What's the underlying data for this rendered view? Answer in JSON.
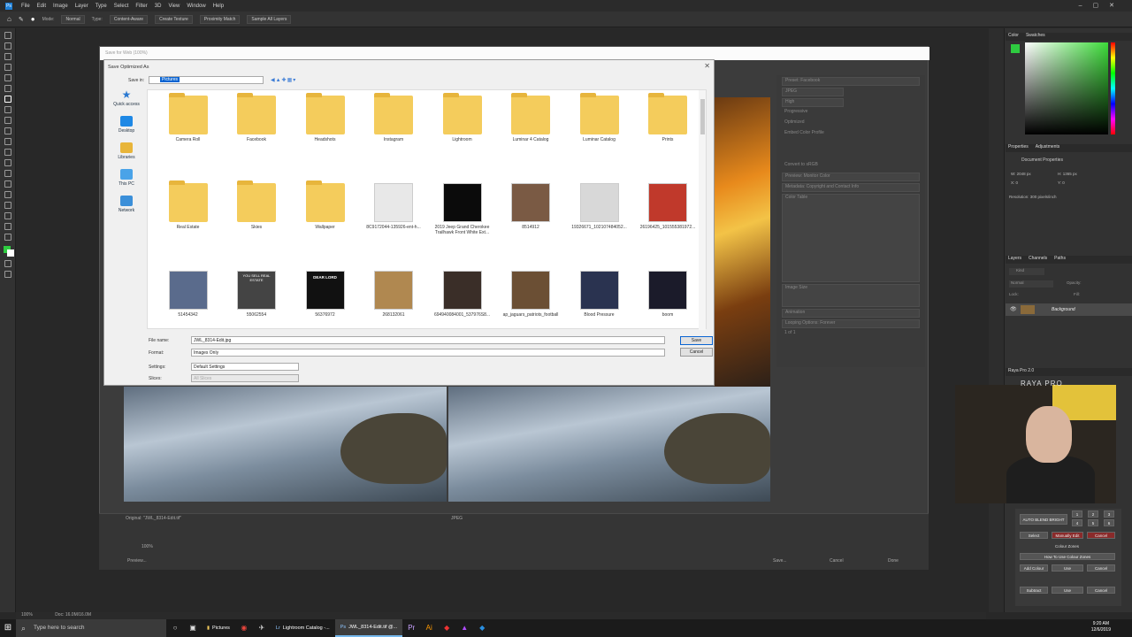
{
  "app": {
    "title": "Photoshop"
  },
  "menu": [
    "File",
    "Edit",
    "Image",
    "Layer",
    "Type",
    "Select",
    "Filter",
    "3D",
    "View",
    "Window",
    "Help"
  ],
  "options": {
    "mode_label": "Mode:",
    "mode_value": "Normal",
    "type_label": "Type:",
    "content_aware": "Content-Aware",
    "create_texture": "Create Texture",
    "proximity": "Proximity Match",
    "sample_all": "Sample All Layers"
  },
  "doc_tab": "JWL_8314-Edit.tif @ 100% (RGB/16) *",
  "sfw": {
    "title": "Save for Web (100%)",
    "preset": "Preset:",
    "preset_value": "Facebook",
    "format": "JPEG",
    "quality": "High",
    "quality_label": "Quality:",
    "progressive": "Progressive",
    "optimized": "Optimized",
    "embed": "Embed Color Profile",
    "convert": "Convert to sRGB",
    "preview": "Preview:",
    "preview_value": "Monitor Color",
    "metadata": "Metadata:",
    "metadata_value": "Copyright and Contact Info",
    "color_table": "Color Table",
    "image_size": "Image Size",
    "animation": "Animation",
    "looping": "Looping Options:",
    "looping_value": "Forever",
    "original": "Original: \"JWL_8314-Edit.tif\"",
    "jpeg": "JPEG",
    "preview_btn": "Preview...",
    "save": "Save...",
    "cancel": "Cancel",
    "done": "Done",
    "zoom": "100%",
    "frame": "1 of 1",
    "quality_right": "Bicubic Sharper"
  },
  "dialog": {
    "title": "Save Optimized As",
    "save_in_label": "Save in:",
    "save_in_value": "Pictures",
    "places": [
      "Quick access",
      "Desktop",
      "Libraries",
      "This PC",
      "Network"
    ],
    "files": [
      {
        "name": "Camera Roll",
        "kind": "folder"
      },
      {
        "name": "Facebook",
        "kind": "folder"
      },
      {
        "name": "Headshots",
        "kind": "folder"
      },
      {
        "name": "Instagram",
        "kind": "folder"
      },
      {
        "name": "Lightroom",
        "kind": "folder"
      },
      {
        "name": "Luminar 4 Catalog",
        "kind": "folder"
      },
      {
        "name": "Luminar Catalog",
        "kind": "folder"
      },
      {
        "name": "Prints",
        "kind": "folder"
      },
      {
        "name": "Real Estate",
        "kind": "folder"
      },
      {
        "name": "Skies",
        "kind": "folder"
      },
      {
        "name": "Wallpaper",
        "kind": "folder"
      },
      {
        "name": "8C9172044-135926-ent-h...",
        "kind": "photo"
      },
      {
        "name": "2019 Jeep Grand Cherokee Trailhawk Front White Ext...",
        "kind": "photo"
      },
      {
        "name": "8514912",
        "kind": "photo"
      },
      {
        "name": "19326671_102107484052...",
        "kind": "photo"
      },
      {
        "name": "26196425_101555381972...",
        "kind": "photo"
      },
      {
        "name": "51454342",
        "kind": "photo"
      },
      {
        "name": "55062554",
        "kind": "photo"
      },
      {
        "name": "56376972",
        "kind": "photo"
      },
      {
        "name": "268132061",
        "kind": "photo"
      },
      {
        "name": "694940084001_537976S8...",
        "kind": "photo"
      },
      {
        "name": "ap_jaguars_patriots_football",
        "kind": "photo"
      },
      {
        "name": "Blood Pressure",
        "kind": "photo"
      },
      {
        "name": "boom",
        "kind": "photo"
      }
    ],
    "file_name_label": "File name:",
    "file_name_value": "JWL_8314-Edit.jpg",
    "format_label": "Format:",
    "format_value": "Images Only",
    "settings_label": "Settings:",
    "settings_value": "Default Settings",
    "slices_label": "Slices:",
    "slices_value": "All Slices",
    "save_btn": "Save",
    "cancel_btn": "Cancel",
    "thumb_text_1": "YOU SELL REAL ESTATE",
    "thumb_text_2": "DEAR LORD"
  },
  "panels": {
    "color_tab": "Color",
    "swatches_tab": "Swatches",
    "properties_tab": "Properties",
    "adjustments_tab": "Adjustments",
    "doc_props": "Document Properties",
    "w": "W: 2048 px",
    "h": "H: 1365 px",
    "x": "X: 0",
    "y": "Y: 0",
    "resolution": "Resolution: 300 pixels/inch",
    "layers_tab": "Layers",
    "channels_tab": "Channels",
    "paths_tab": "Paths",
    "kind": "Kind",
    "normal": "Normal",
    "opacity": "Opacity:",
    "lock": "Lock:",
    "fill": "Fill:",
    "layer_name": "Background"
  },
  "raya": {
    "title": "Raya Pro 2.0",
    "logo": "RAYA PRO",
    "btns": [
      "AUTO BLEND BRIGHT",
      "Select",
      "Manually Edit",
      "Cancel",
      "Colour Zones",
      "How To Use Colour Zones",
      "Add Colour",
      "Use",
      "Cancel",
      "Subtract",
      "Use",
      "Cancel"
    ],
    "nums": [
      "1",
      "2",
      "3",
      "4",
      "5",
      "6"
    ]
  },
  "status": {
    "zoom": "100%",
    "doc": "Doc: 16.0M/16.0M"
  },
  "taskbar": {
    "search": "Type here to search",
    "pictures": "Pictures",
    "lightroom": "Lightroom Catalog -...",
    "photoshop": "JWL_8314-Edit.tif @...",
    "time": "9:20 AM",
    "date": "12/6/2019"
  },
  "colors": {
    "accent": "#0a64d2",
    "fg": "#2ecc40",
    "folder": "#f4cc5c"
  }
}
